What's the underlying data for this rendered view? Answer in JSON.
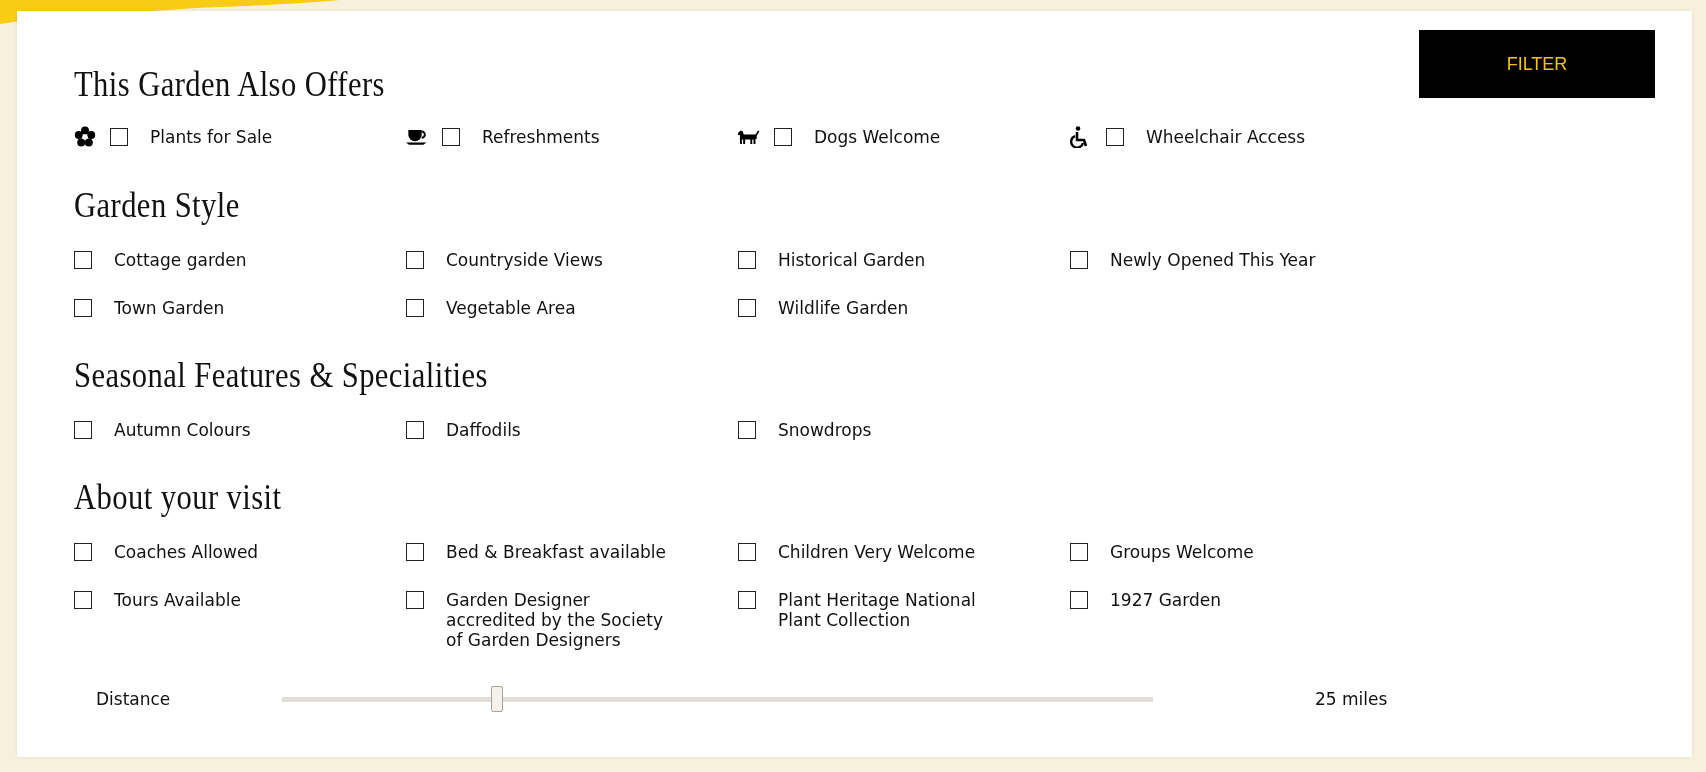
{
  "filter_button": {
    "label": "FILTER"
  },
  "sections": [
    {
      "title": "This Garden Also Offers",
      "kind": "amenities",
      "options": [
        {
          "label": "Plants for Sale",
          "checked": false
        },
        {
          "label": "Refreshments",
          "checked": false
        },
        {
          "label": "Dogs Welcome",
          "checked": false
        },
        {
          "label": "Wheelchair Access",
          "checked": false
        }
      ]
    },
    {
      "title": "Garden Style",
      "kind": "plain",
      "options": [
        {
          "label": "Cottage garden",
          "checked": false
        },
        {
          "label": "Countryside Views",
          "checked": false
        },
        {
          "label": "Historical Garden",
          "checked": false
        },
        {
          "label": "Newly Opened This Year",
          "checked": false
        },
        {
          "label": "Town Garden",
          "checked": false
        },
        {
          "label": "Vegetable Area",
          "checked": false
        },
        {
          "label": "Wildlife Garden",
          "checked": false
        }
      ]
    },
    {
      "title": "Seasonal Features & Specialities",
      "kind": "plain",
      "options": [
        {
          "label": "Autumn Colours",
          "checked": false
        },
        {
          "label": "Daffodils",
          "checked": false
        },
        {
          "label": "Snowdrops",
          "checked": false
        }
      ]
    },
    {
      "title": "About your visit",
      "kind": "plain",
      "options": [
        {
          "label": "Coaches Allowed",
          "checked": false
        },
        {
          "label": "Bed & Breakfast available",
          "checked": false
        },
        {
          "label": "Children Very Welcome",
          "checked": false
        },
        {
          "label": "Groups Welcome",
          "checked": false
        },
        {
          "label": "Tours Available",
          "checked": false
        },
        {
          "label": "Garden Designer accredited by the Society of Garden Designers",
          "checked": false
        },
        {
          "label": "Plant Heritage National Plant Collection",
          "checked": false
        },
        {
          "label": "1927 Garden",
          "checked": false
        }
      ]
    }
  ],
  "distance": {
    "label": "Distance",
    "level": 0.247,
    "reading": "25 miles"
  }
}
